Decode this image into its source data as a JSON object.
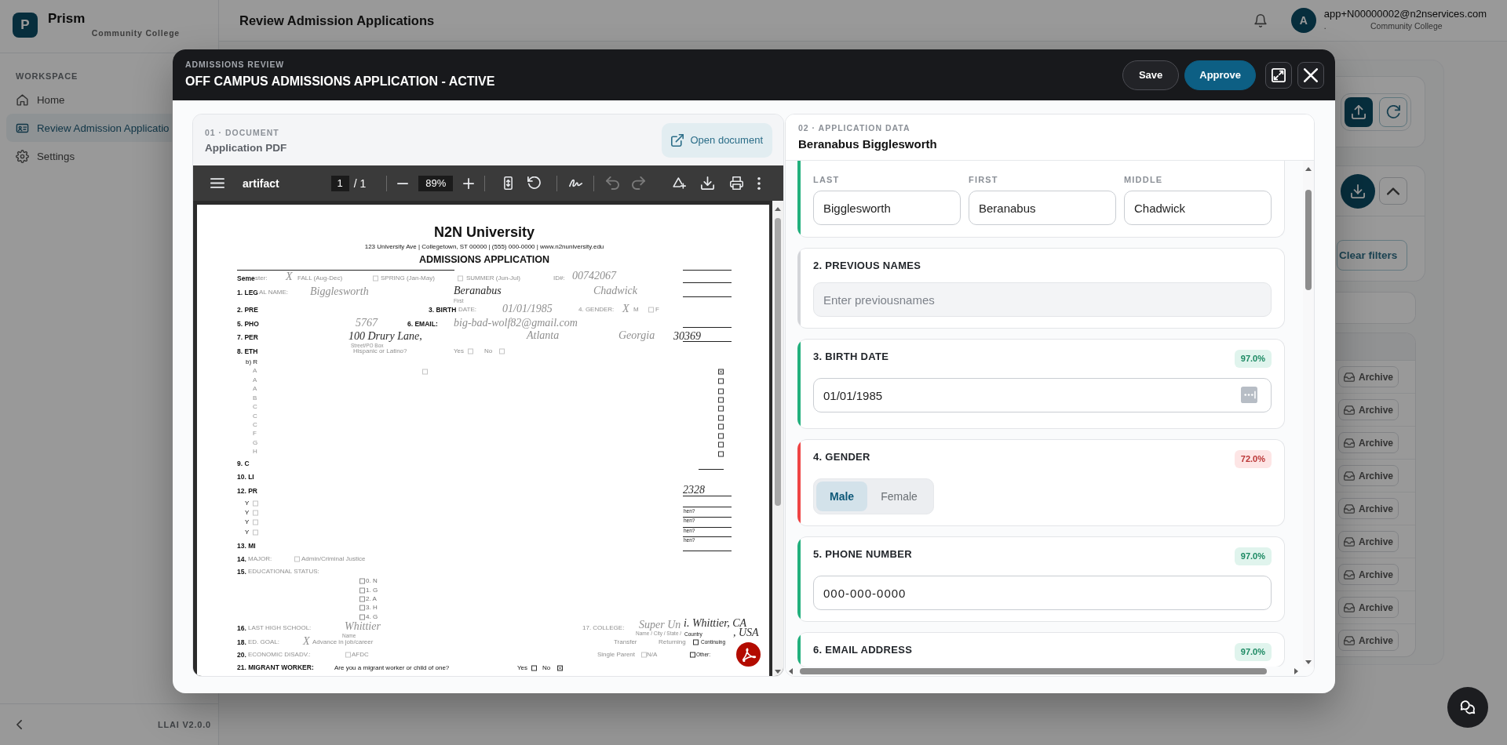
{
  "sidebar": {
    "logo_letter": "P",
    "brand": "Prism",
    "subtitle": "Community College",
    "section_label": "WORKSPACE",
    "items": [
      {
        "label": "Home",
        "selected": false
      },
      {
        "label": "Review Admission Applicatio",
        "selected": true
      },
      {
        "label": "Settings",
        "selected": false
      }
    ],
    "version": "LLAI V2.0.0"
  },
  "header": {
    "title": "Review Admission Applications",
    "user": {
      "initial": "A",
      "email": "app+N00000002@n2nservices.com",
      "department": ".",
      "organization": "Community College"
    }
  },
  "main_panel": {
    "filter_button": "Clear filters",
    "rows": [
      {
        "action": "Archive"
      },
      {
        "action": "Archive"
      },
      {
        "action": "Archive"
      },
      {
        "action": "Archive"
      },
      {
        "action": "Archive"
      },
      {
        "action": "Archive"
      },
      {
        "action": "Archive"
      },
      {
        "action": "Archive"
      },
      {
        "action": "Archive"
      }
    ]
  },
  "modal": {
    "eyebrow": "ADMISSIONS REVIEW",
    "title": "OFF CAMPUS ADMISSIONS APPLICATION - ACTIVE",
    "actions": [
      {
        "kind": "save",
        "label": "Save"
      },
      {
        "kind": "approve",
        "label": "Approve"
      }
    ],
    "document_panel": {
      "step": "01 · DOCUMENT",
      "title": "Application PDF",
      "open_button": "Open document",
      "viewer": {
        "file_name": "artifact",
        "page": "1",
        "page_of": "/ 1",
        "zoom": "89%",
        "undo_disabled": true,
        "redo_disabled": true,
        "page_items": [
          {
            "kind": "title",
            "text": "N2N University"
          },
          {
            "kind": "address",
            "text": "123 University Ave | Collegetown, ST 00000 | (555) 000-0000 | www.n2nuniversity.edu"
          },
          {
            "kind": "heading",
            "text": "ADMISSIONS APPLICATION"
          },
          {
            "kind": "label",
            "text": "Seme"
          },
          {
            "kind": "faint",
            "text": "ster:"
          },
          {
            "kind": "hand_faint",
            "text": "X"
          },
          {
            "kind": "faint",
            "text": "FALL (Aug-Dec)"
          },
          {
            "kind": "checkbox_faint",
            "checked": false
          },
          {
            "kind": "faint",
            "text": "SPRING (Jan-May)"
          },
          {
            "kind": "checkbox_faint",
            "checked": false
          },
          {
            "kind": "faint",
            "text": "SUMMER (Jun-Jul)"
          },
          {
            "kind": "faint",
            "text": "ID#:"
          },
          {
            "kind": "hand_faint",
            "text": "00742067"
          },
          {
            "kind": "label",
            "text": "1. LEG"
          },
          {
            "kind": "faint",
            "text": "AL NAME:"
          },
          {
            "kind": "hand_faint",
            "text": "Bigglesworth"
          },
          {
            "kind": "hand",
            "text": "Beranabus"
          },
          {
            "kind": "small_faint",
            "text": "First"
          },
          {
            "kind": "hand_faint",
            "text": "Chadwick"
          },
          {
            "kind": "label",
            "text": "2. PRE"
          },
          {
            "kind": "label",
            "text": "3. BIRTH"
          },
          {
            "kind": "faint",
            "text": "DATE:"
          },
          {
            "kind": "hand_faint",
            "text": "01/01/1985"
          },
          {
            "kind": "faint",
            "text": "4. GENDER:"
          },
          {
            "kind": "hand_faint",
            "text": "X"
          },
          {
            "kind": "faint",
            "text": "M"
          },
          {
            "kind": "checkbox_faint",
            "checked": false
          },
          {
            "kind": "faint",
            "text": "F"
          },
          {
            "kind": "label",
            "text": "5. PHO"
          },
          {
            "kind": "hand_faint",
            "text": "5767"
          },
          {
            "kind": "label",
            "text": "6. EMAIL:"
          },
          {
            "kind": "hand_faint",
            "text": "big-bad-wolf82@gmail.com"
          },
          {
            "kind": "label",
            "text": "7. PER"
          },
          {
            "kind": "hand",
            "text": "100 Drury Lane,"
          },
          {
            "kind": "hand_faint",
            "text": "Atlanta"
          },
          {
            "kind": "hand_faint",
            "text": "Georgia"
          },
          {
            "kind": "hand",
            "text": "30369"
          },
          {
            "kind": "small_faint",
            "text": "Street/PO Box"
          },
          {
            "kind": "label",
            "text": "8. ETH"
          },
          {
            "kind": "faint",
            "text": "Hispanic or Latino?"
          },
          {
            "kind": "faint",
            "text": "Yes"
          },
          {
            "kind": "checkbox_faint",
            "checked": false
          },
          {
            "kind": "faint",
            "text": "No"
          },
          {
            "kind": "checkbox_faint",
            "checked": false
          },
          {
            "kind": "text",
            "text": "b) R"
          },
          {
            "kind": "checkbox_faint",
            "checked": false
          },
          {
            "kind": "faint",
            "text": "A"
          },
          {
            "kind": "faint",
            "text": "A"
          },
          {
            "kind": "faint",
            "text": "A"
          },
          {
            "kind": "faint",
            "text": "B"
          },
          {
            "kind": "faint",
            "text": "C"
          },
          {
            "kind": "faint",
            "text": "C"
          },
          {
            "kind": "faint",
            "text": "C"
          },
          {
            "kind": "faint",
            "text": "F"
          },
          {
            "kind": "faint",
            "text": "G"
          },
          {
            "kind": "faint",
            "text": "H"
          },
          {
            "kind": "checkbox",
            "checked": true
          },
          {
            "kind": "checkbox",
            "checked": false
          },
          {
            "kind": "checkbox",
            "checked": false
          },
          {
            "kind": "checkbox",
            "checked": false
          },
          {
            "kind": "checkbox",
            "checked": false
          },
          {
            "kind": "checkbox",
            "checked": false
          },
          {
            "kind": "checkbox",
            "checked": false
          },
          {
            "kind": "checkbox",
            "checked": false
          },
          {
            "kind": "checkbox",
            "checked": false
          },
          {
            "kind": "checkbox",
            "checked": false
          },
          {
            "kind": "label",
            "text": "9. C"
          },
          {
            "kind": "label",
            "text": "10. LI"
          },
          {
            "kind": "label",
            "text": "12. PR"
          },
          {
            "kind": "text",
            "text": "Y"
          },
          {
            "kind": "text",
            "text": "Y"
          },
          {
            "kind": "text",
            "text": "Y"
          },
          {
            "kind": "text",
            "text": "Y"
          },
          {
            "kind": "checkbox_faint",
            "checked": false
          },
          {
            "kind": "checkbox_faint",
            "checked": false
          },
          {
            "kind": "checkbox_faint",
            "checked": false
          },
          {
            "kind": "checkbox_faint",
            "checked": false
          },
          {
            "kind": "hand",
            "text": "2328"
          },
          {
            "kind": "small",
            "text": "hen?"
          },
          {
            "kind": "small",
            "text": "hen?"
          },
          {
            "kind": "small",
            "text": "hen?"
          },
          {
            "kind": "small",
            "text": "hen?"
          },
          {
            "kind": "label",
            "text": "13. MI"
          },
          {
            "kind": "label",
            "text": "14."
          },
          {
            "kind": "faint",
            "text": "MAJOR:"
          },
          {
            "kind": "checkbox_faint",
            "checked": false
          },
          {
            "kind": "faint",
            "text": "Admin/Criminal Justice"
          },
          {
            "kind": "label",
            "text": "15."
          },
          {
            "kind": "faint",
            "text": "EDUCATIONAL STATUS:"
          },
          {
            "kind": "checkbox_mid",
            "checked": false
          },
          {
            "kind": "checkbox_mid",
            "checked": false
          },
          {
            "kind": "checkbox_mid",
            "checked": false
          },
          {
            "kind": "checkbox_mid",
            "checked": false
          },
          {
            "kind": "checkbox_mid",
            "checked": false
          },
          {
            "kind": "mid",
            "text": "0. N"
          },
          {
            "kind": "mid",
            "text": "1. G"
          },
          {
            "kind": "mid",
            "text": "2. A"
          },
          {
            "kind": "mid",
            "text": "3. H"
          },
          {
            "kind": "mid",
            "text": "4. G"
          },
          {
            "kind": "label",
            "text": "16."
          },
          {
            "kind": "faint",
            "text": "LAST HIGH SCHOOL:"
          },
          {
            "kind": "hand_faint",
            "text": "Whittier"
          },
          {
            "kind": "faint",
            "text": "17. COLLEGE:"
          },
          {
            "kind": "hand_faint",
            "text": "Super Un"
          },
          {
            "kind": "hand",
            "text": "i. Whittier, CA"
          },
          {
            "kind": "small_faint",
            "text": "Name"
          },
          {
            "kind": "small_faint",
            "text": "Name / City / State /"
          },
          {
            "kind": "small",
            "text": "Country"
          },
          {
            "kind": "hand",
            "text": ", USA"
          },
          {
            "kind": "label",
            "text": "18."
          },
          {
            "kind": "faint",
            "text": "ED. GOAL:"
          },
          {
            "kind": "hand_faint",
            "text": "X"
          },
          {
            "kind": "faint",
            "text": "Advance in job/career"
          },
          {
            "kind": "faint",
            "text": "Transfer"
          },
          {
            "kind": "faint",
            "text": "Returning"
          },
          {
            "kind": "checkbox",
            "checked": false
          },
          {
            "kind": "small",
            "text": "Continuing"
          },
          {
            "kind": "label",
            "text": "20."
          },
          {
            "kind": "faint",
            "text": "ECONOMIC DISADV.:"
          },
          {
            "kind": "checkbox_faint",
            "checked": false
          },
          {
            "kind": "faint",
            "text": "AFDC"
          },
          {
            "kind": "faint",
            "text": "Single Parent"
          },
          {
            "kind": "checkbox_faint",
            "checked": false
          },
          {
            "kind": "faint",
            "text": "N/A"
          },
          {
            "kind": "checkbox",
            "checked": false
          },
          {
            "kind": "small",
            "text": "Other:"
          },
          {
            "kind": "label",
            "text": "21. MIGRANT WORKER:"
          },
          {
            "kind": "text",
            "text": "Are you a migrant worker or child of one?"
          },
          {
            "kind": "text",
            "text": "Yes"
          },
          {
            "kind": "checkbox",
            "checked": false
          },
          {
            "kind": "text",
            "text": "No"
          },
          {
            "kind": "checkbox",
            "checked": true
          }
        ]
      }
    },
    "data_panel": {
      "step": "02 · APPLICATION DATA",
      "applicant": "Beranabus Bigglesworth",
      "fields": [
        {
          "kind": "name_parts",
          "color": "#22b07d",
          "parts": [
            {
              "label": "LAST",
              "value": "Bigglesworth"
            },
            {
              "label": "FIRST",
              "value": "Beranabus"
            },
            {
              "label": "MIDDLE",
              "value": "Chadwick"
            }
          ]
        },
        {
          "kind": "text",
          "color": "#d3d5d9",
          "label": "2. PREVIOUS NAMES",
          "placeholder": "Enter previousnames"
        },
        {
          "kind": "date",
          "color": "#22b07d",
          "label": "3. BIRTH DATE",
          "confidence": "97.0%",
          "value": "01/01/1985"
        },
        {
          "kind": "choice",
          "color": "#ef4444",
          "label": "4. GENDER",
          "confidence": "72.0%",
          "options": [
            {
              "label": "Male",
              "selected": true
            },
            {
              "label": "Female",
              "selected": false
            }
          ]
        },
        {
          "kind": "phone",
          "color": "#22b07d",
          "label": "5. PHONE NUMBER",
          "confidence": "97.0%",
          "value": "000-000-0000"
        },
        {
          "kind": "text",
          "color": "#22b07d",
          "label": "6. EMAIL ADDRESS",
          "confidence": "97.0%"
        }
      ]
    }
  }
}
